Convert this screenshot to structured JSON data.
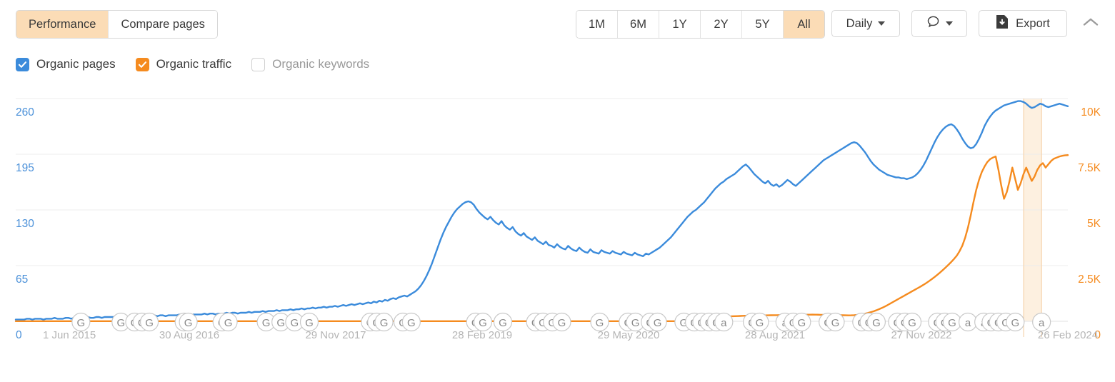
{
  "toolbar": {
    "tabs": [
      {
        "label": "Performance",
        "active": true
      },
      {
        "label": "Compare pages",
        "active": false
      }
    ],
    "ranges": [
      {
        "label": "1M",
        "active": false
      },
      {
        "label": "6M",
        "active": false
      },
      {
        "label": "1Y",
        "active": false
      },
      {
        "label": "2Y",
        "active": false
      },
      {
        "label": "5Y",
        "active": false
      },
      {
        "label": "All",
        "active": true
      }
    ],
    "granularity": "Daily",
    "notes_icon": "speech-bubble-icon",
    "export_label": "Export",
    "export_icon": "download-file-icon",
    "collapse_icon": "chevron-up-icon"
  },
  "legend": {
    "items": [
      {
        "label": "Organic pages",
        "checked": true,
        "color": "#3b8bdb"
      },
      {
        "label": "Organic traffic",
        "checked": true,
        "color": "#f58b1f"
      },
      {
        "label": "Organic keywords",
        "checked": false,
        "color": "#cfcfcf"
      }
    ]
  },
  "colors": {
    "blue": "#3b8bdb",
    "orange": "#f58b1f",
    "tab_active_bg": "#fbdcb6",
    "grid": "#ececec",
    "highlight_band": "#fdf0e0",
    "marker_stroke": "#c9c9c9",
    "marker_text": "#8a8a8a"
  },
  "chart_data": {
    "type": "line",
    "title": "",
    "xlabel": "",
    "grid": true,
    "legend_position": "top-left",
    "x_ticks": [
      "1 Jun 2015",
      "30 Aug 2016",
      "29 Nov 2017",
      "28 Feb 2019",
      "29 May 2020",
      "28 Aug 2021",
      "27 Nov 2022",
      "26 Feb 2024"
    ],
    "y_left": {
      "name": "Organic pages",
      "color": "#3b8bdb",
      "ticks": [
        "0",
        "65",
        "130",
        "195",
        "260"
      ],
      "ylim": [
        0,
        260
      ]
    },
    "y_right": {
      "name": "Organic traffic",
      "color": "#f58b1f",
      "ticks": [
        "0",
        "2.5K",
        "5K",
        "7.5K",
        "10K"
      ],
      "ylim": [
        0,
        10000
      ]
    },
    "series": [
      {
        "name": "Organic pages",
        "color": "#3b8bdb",
        "axis": "left",
        "values": [
          2,
          2,
          2,
          2,
          3,
          3,
          2,
          3,
          3,
          3,
          2,
          3,
          3,
          3,
          4,
          3,
          3,
          3,
          4,
          4,
          3,
          4,
          4,
          4,
          4,
          4,
          5,
          4,
          4,
          5,
          5,
          4,
          5,
          5,
          5,
          5,
          5,
          5,
          5,
          6,
          5,
          6,
          6,
          5,
          6,
          6,
          6,
          6,
          6,
          6,
          7,
          6,
          7,
          7,
          6,
          7,
          7,
          7,
          7,
          8,
          7,
          8,
          8,
          7,
          8,
          8,
          8,
          8,
          9,
          8,
          9,
          9,
          8,
          9,
          9,
          9,
          10,
          9,
          10,
          10,
          9,
          10,
          10,
          10,
          11,
          10,
          11,
          11,
          11,
          12,
          11,
          12,
          12,
          12,
          13,
          12,
          13,
          13,
          13,
          14,
          13,
          14,
          14,
          15,
          14,
          15,
          15,
          16,
          15,
          16,
          16,
          17,
          16,
          17,
          17,
          18,
          17,
          18,
          19,
          18,
          19,
          20,
          19,
          20,
          21,
          20,
          21,
          22,
          21,
          23,
          22,
          24,
          23,
          25,
          24,
          26,
          27,
          26,
          28,
          29,
          30,
          29,
          31,
          33,
          35,
          38,
          42,
          47,
          53,
          60,
          68,
          77,
          86,
          95,
          103,
          110,
          116,
          122,
          127,
          131,
          134,
          137,
          139,
          140,
          139,
          136,
          131,
          127,
          124,
          121,
          119,
          122,
          118,
          115,
          113,
          117,
          112,
          109,
          107,
          110,
          105,
          102,
          100,
          103,
          99,
          97,
          95,
          98,
          94,
          92,
          90,
          93,
          89,
          88,
          86,
          90,
          87,
          85,
          84,
          88,
          85,
          83,
          82,
          86,
          83,
          81,
          80,
          84,
          81,
          80,
          79,
          83,
          81,
          80,
          79,
          82,
          80,
          79,
          78,
          81,
          79,
          78,
          77,
          80,
          78,
          77,
          76,
          79,
          78,
          80,
          82,
          84,
          86,
          89,
          92,
          95,
          98,
          102,
          106,
          110,
          114,
          118,
          122,
          125,
          128,
          130,
          133,
          136,
          139,
          143,
          147,
          151,
          155,
          158,
          161,
          163,
          166,
          168,
          170,
          172,
          175,
          178,
          181,
          183,
          180,
          176,
          172,
          169,
          166,
          163,
          161,
          164,
          160,
          158,
          160,
          157,
          159,
          162,
          165,
          163,
          160,
          158,
          161,
          164,
          167,
          170,
          173,
          176,
          179,
          182,
          185,
          188,
          190,
          192,
          194,
          196,
          198,
          200,
          202,
          204,
          206,
          208,
          209,
          208,
          205,
          201,
          197,
          192,
          187,
          183,
          180,
          177,
          175,
          173,
          171,
          170,
          169,
          168,
          168,
          167,
          167,
          166,
          167,
          168,
          170,
          173,
          177,
          182,
          188,
          195,
          202,
          209,
          215,
          220,
          224,
          227,
          229,
          230,
          228,
          224,
          219,
          213,
          208,
          204,
          202,
          203,
          207,
          213,
          220,
          228,
          234,
          239,
          243,
          246,
          248,
          250,
          252,
          253,
          254,
          255,
          256,
          257,
          257,
          256,
          254,
          251,
          249,
          250,
          252,
          254,
          253,
          251,
          250,
          251,
          252,
          253,
          254,
          253,
          252,
          251
        ]
      },
      {
        "name": "Organic traffic",
        "color": "#f58b1f",
        "axis": "right",
        "values": [
          5,
          5,
          5,
          5,
          5,
          5,
          5,
          5,
          5,
          5,
          5,
          5,
          5,
          5,
          5,
          5,
          5,
          5,
          5,
          5,
          5,
          5,
          5,
          5,
          5,
          5,
          5,
          5,
          5,
          5,
          5,
          5,
          5,
          5,
          5,
          5,
          5,
          5,
          5,
          5,
          5,
          5,
          5,
          5,
          5,
          5,
          5,
          5,
          5,
          5,
          5,
          5,
          5,
          5,
          5,
          5,
          5,
          5,
          5,
          5,
          5,
          5,
          5,
          5,
          5,
          5,
          5,
          5,
          5,
          5,
          5,
          5,
          5,
          5,
          5,
          5,
          5,
          5,
          5,
          5,
          5,
          5,
          5,
          5,
          5,
          5,
          5,
          5,
          5,
          5,
          5,
          5,
          5,
          5,
          5,
          5,
          5,
          5,
          5,
          5,
          5,
          5,
          5,
          5,
          5,
          5,
          5,
          5,
          5,
          5,
          5,
          5,
          5,
          5,
          5,
          5,
          5,
          5,
          5,
          5,
          5,
          5,
          5,
          5,
          5,
          5,
          5,
          5,
          5,
          5,
          5,
          5,
          5,
          5,
          5,
          5,
          5,
          5,
          5,
          5,
          5,
          5,
          5,
          5,
          5,
          5,
          5,
          5,
          5,
          5,
          5,
          5,
          5,
          5,
          5,
          5,
          5,
          5,
          5,
          5,
          5,
          5,
          5,
          5,
          5,
          5,
          5,
          5,
          5,
          5,
          5,
          5,
          5,
          5,
          5,
          5,
          5,
          5,
          5,
          5,
          5,
          5,
          5,
          5,
          5,
          5,
          5,
          5,
          5,
          5,
          5,
          5,
          5,
          5,
          5,
          5,
          5,
          5,
          5,
          5,
          5,
          5,
          5,
          5,
          5,
          5,
          5,
          5,
          5,
          5,
          5,
          5,
          5,
          5,
          5,
          5,
          5,
          5,
          5,
          5,
          5,
          5,
          5,
          5,
          5,
          5,
          5,
          5,
          5,
          5,
          5,
          5,
          5,
          5,
          5,
          5,
          5,
          5,
          5,
          5,
          20,
          30,
          40,
          55,
          70,
          85,
          100,
          115,
          130,
          145,
          160,
          175,
          185,
          195,
          205,
          210,
          215,
          220,
          225,
          230,
          235,
          240,
          245,
          250,
          255,
          258,
          260,
          262,
          264,
          266,
          268,
          270,
          272,
          274,
          276,
          278,
          280,
          282,
          284,
          286,
          288,
          290,
          292,
          294,
          296,
          298,
          300,
          302,
          300,
          296,
          292,
          288,
          284,
          282,
          280,
          278,
          276,
          274,
          272,
          270,
          268,
          270,
          275,
          285,
          300,
          320,
          345,
          375,
          410,
          450,
          495,
          545,
          600,
          660,
          725,
          795,
          865,
          935,
          1005,
          1075,
          1145,
          1215,
          1285,
          1355,
          1425,
          1495,
          1565,
          1640,
          1720,
          1805,
          1895,
          1990,
          2090,
          2195,
          2305,
          2420,
          2540,
          2665,
          2800,
          2950,
          3150,
          3400,
          3750,
          4200,
          4750,
          5350,
          5900,
          6350,
          6700,
          6950,
          7150,
          7280,
          7350,
          7400,
          6800,
          6100,
          5500,
          5800,
          6300,
          6900,
          6400,
          5900,
          6200,
          6600,
          6900,
          6600,
          6300,
          6500,
          6800,
          7000,
          7100,
          6900,
          7050,
          7200,
          7300,
          7350,
          7400,
          7430,
          7450,
          7460
        ]
      }
    ],
    "markers": [
      {
        "label": "G",
        "x_frac": 0.062
      },
      {
        "label": "G",
        "x_frac": 0.1
      },
      {
        "label": "G",
        "x_frac": 0.113
      },
      {
        "label": "G",
        "x_frac": 0.12
      },
      {
        "label": "G",
        "x_frac": 0.127
      },
      {
        "label": "G",
        "x_frac": 0.16
      },
      {
        "label": "G",
        "x_frac": 0.164
      },
      {
        "label": "G",
        "x_frac": 0.196
      },
      {
        "label": "G",
        "x_frac": 0.202
      },
      {
        "label": "G",
        "x_frac": 0.238
      },
      {
        "label": "G",
        "x_frac": 0.252
      },
      {
        "label": "G",
        "x_frac": 0.265
      },
      {
        "label": "G",
        "x_frac": 0.279
      },
      {
        "label": "G",
        "x_frac": 0.337
      },
      {
        "label": "G",
        "x_frac": 0.343
      },
      {
        "label": "G",
        "x_frac": 0.35
      },
      {
        "label": "G",
        "x_frac": 0.368
      },
      {
        "label": "G",
        "x_frac": 0.376
      },
      {
        "label": "G",
        "x_frac": 0.437
      },
      {
        "label": "G",
        "x_frac": 0.444
      },
      {
        "label": "G",
        "x_frac": 0.463
      },
      {
        "label": "G",
        "x_frac": 0.494
      },
      {
        "label": "G",
        "x_frac": 0.501
      },
      {
        "label": "G",
        "x_frac": 0.51
      },
      {
        "label": "G",
        "x_frac": 0.519
      },
      {
        "label": "G",
        "x_frac": 0.555
      },
      {
        "label": "G",
        "x_frac": 0.582
      },
      {
        "label": "G",
        "x_frac": 0.589
      },
      {
        "label": "G",
        "x_frac": 0.603
      },
      {
        "label": "G",
        "x_frac": 0.61
      },
      {
        "label": "G",
        "x_frac": 0.635
      },
      {
        "label": "G",
        "x_frac": 0.645
      },
      {
        "label": "G",
        "x_frac": 0.652
      },
      {
        "label": "G",
        "x_frac": 0.659
      },
      {
        "label": "G",
        "x_frac": 0.666
      },
      {
        "label": "a",
        "x_frac": 0.673
      },
      {
        "label": "G",
        "x_frac": 0.7
      },
      {
        "label": "G",
        "x_frac": 0.707
      },
      {
        "label": "a",
        "x_frac": 0.731
      },
      {
        "label": "G",
        "x_frac": 0.739
      },
      {
        "label": "G",
        "x_frac": 0.747
      },
      {
        "label": "G",
        "x_frac": 0.772
      },
      {
        "label": "G",
        "x_frac": 0.779
      },
      {
        "label": "G",
        "x_frac": 0.804
      },
      {
        "label": "G",
        "x_frac": 0.811
      },
      {
        "label": "G",
        "x_frac": 0.818
      },
      {
        "label": "G",
        "x_frac": 0.838
      },
      {
        "label": "G",
        "x_frac": 0.845
      },
      {
        "label": "G",
        "x_frac": 0.852
      },
      {
        "label": "G",
        "x_frac": 0.876
      },
      {
        "label": "G",
        "x_frac": 0.883
      },
      {
        "label": "G",
        "x_frac": 0.89
      },
      {
        "label": "a",
        "x_frac": 0.905
      },
      {
        "label": "a",
        "x_frac": 0.92
      },
      {
        "label": "G",
        "x_frac": 0.927
      },
      {
        "label": "G",
        "x_frac": 0.934
      },
      {
        "label": "G",
        "x_frac": 0.941
      },
      {
        "label": "G",
        "x_frac": 0.95
      },
      {
        "label": "a",
        "x_frac": 0.975
      }
    ],
    "highlight": {
      "from_frac": 0.958,
      "to_frac": 0.975
    }
  }
}
